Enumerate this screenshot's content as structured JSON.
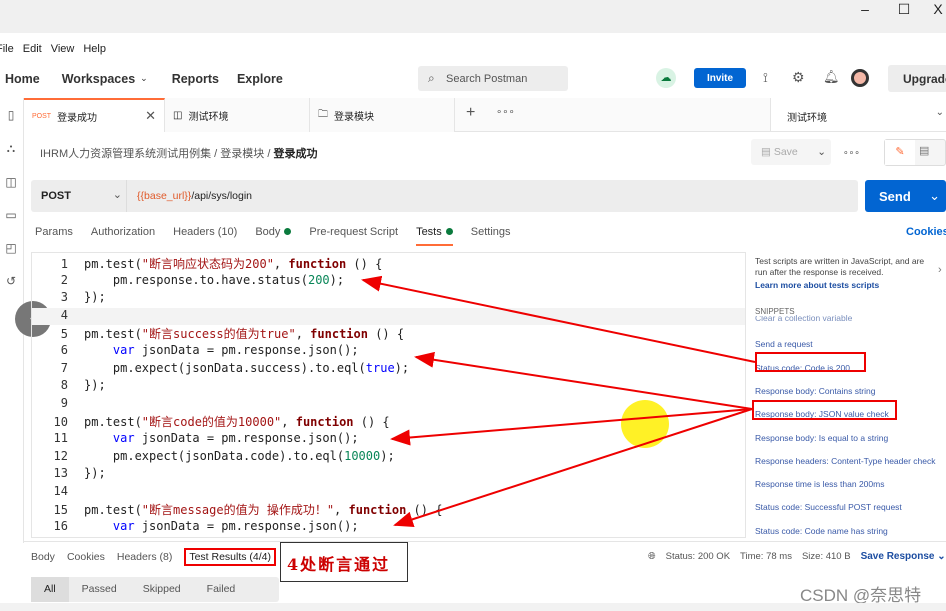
{
  "window": {
    "minimize": "–",
    "maximize": "☐",
    "close": "X"
  },
  "menu": [
    "File",
    "Edit",
    "View",
    "Help"
  ],
  "nav": {
    "home": "Home",
    "workspaces": "Workspaces",
    "reports": "Reports",
    "explore": "Explore",
    "search_placeholder": "Search Postman",
    "invite": "Invite",
    "upgrade": "Upgrade"
  },
  "tabs": [
    {
      "method": "POST",
      "label": "登录成功"
    },
    {
      "label": "测试环境"
    },
    {
      "label": "登录模块"
    }
  ],
  "environment": "测试环境",
  "breadcrumb": [
    "IHRM人力资源管理系统测试用例集",
    "登录模块",
    "登录成功"
  ],
  "request": {
    "method": "POST",
    "url_var": "{{base_url}}",
    "url_path": "/api/sys/login",
    "send": "Send",
    "save": "Save"
  },
  "request_tabs": [
    "Params",
    "Authorization",
    "Headers (10)",
    "Body",
    "Pre-request Script",
    "Tests",
    "Settings"
  ],
  "cookies": "Cookies",
  "code": [
    [
      {
        "t": "pm.test(",
        "c": ""
      },
      {
        "t": "\"断言响应状态码为200\"",
        "c": "st"
      },
      {
        "t": ", ",
        "c": ""
      },
      {
        "t": "function",
        "c": "kw"
      },
      {
        "t": " () {",
        "c": ""
      }
    ],
    [
      {
        "t": "    pm.response.to.have.status(",
        "c": ""
      },
      {
        "t": "200",
        "c": "nm"
      },
      {
        "t": ");",
        "c": ""
      }
    ],
    [
      {
        "t": "});",
        "c": ""
      }
    ],
    [],
    [
      {
        "t": "pm.test(",
        "c": ""
      },
      {
        "t": "\"断言success的值为true\"",
        "c": "st"
      },
      {
        "t": ", ",
        "c": ""
      },
      {
        "t": "function",
        "c": "kw"
      },
      {
        "t": " () {",
        "c": ""
      }
    ],
    [
      {
        "t": "    ",
        "c": ""
      },
      {
        "t": "var",
        "c": "tr"
      },
      {
        "t": " jsonData = pm.response.json();",
        "c": ""
      }
    ],
    [
      {
        "t": "    pm.expect(jsonData.success).to.eql(",
        "c": ""
      },
      {
        "t": "true",
        "c": "tr"
      },
      {
        "t": ");",
        "c": ""
      }
    ],
    [
      {
        "t": "});",
        "c": ""
      }
    ],
    [],
    [
      {
        "t": "pm.test(",
        "c": ""
      },
      {
        "t": "\"断言code的值为10000\"",
        "c": "st"
      },
      {
        "t": ", ",
        "c": ""
      },
      {
        "t": "function",
        "c": "kw"
      },
      {
        "t": " () {",
        "c": ""
      }
    ],
    [
      {
        "t": "    ",
        "c": ""
      },
      {
        "t": "var",
        "c": "tr"
      },
      {
        "t": " jsonData = pm.response.json();",
        "c": ""
      }
    ],
    [
      {
        "t": "    pm.expect(jsonData.code).to.eql(",
        "c": ""
      },
      {
        "t": "10000",
        "c": "nm"
      },
      {
        "t": ");",
        "c": ""
      }
    ],
    [
      {
        "t": "});",
        "c": ""
      }
    ],
    [],
    [
      {
        "t": "pm.test(",
        "c": ""
      },
      {
        "t": "\"断言message的值为 操作成功！\"",
        "c": "st"
      },
      {
        "t": ", ",
        "c": ""
      },
      {
        "t": "function",
        "c": "kw"
      },
      {
        "t": " () {",
        "c": ""
      }
    ],
    [
      {
        "t": "    ",
        "c": ""
      },
      {
        "t": "var",
        "c": "tr"
      },
      {
        "t": " jsonData = pm.response.json();",
        "c": ""
      }
    ]
  ],
  "panel": {
    "intro": "Test scripts are written in JavaScript, and are run after the response is received.",
    "learn": "Learn more about tests scripts",
    "snippets_title": "SNIPPETS",
    "snippets": [
      "Clear a collection variable",
      "Send a request",
      "Status code: Code is 200",
      "Response body: Contains string",
      "Response body: JSON value check",
      "Response body: Is equal to a string",
      "Response headers: Content-Type header check",
      "Response time is less than 200ms",
      "Status code: Successful POST request",
      "Status code: Code name has string"
    ]
  },
  "response_tabs": [
    "Body",
    "Cookies",
    "Headers (8)",
    "Test Results (4/4)"
  ],
  "annotation": "4处断言通过",
  "status": {
    "status": "Status: 200 OK",
    "time": "Time: 78 ms",
    "size": "Size: 410 B",
    "save": "Save Response"
  },
  "filters": [
    "All",
    "Passed",
    "Skipped",
    "Failed"
  ],
  "watermark": "CSDN @奈思特",
  "colors": {
    "accent": "#ff6c37",
    "primary": "#0265d2",
    "annotation": "#e00000"
  }
}
